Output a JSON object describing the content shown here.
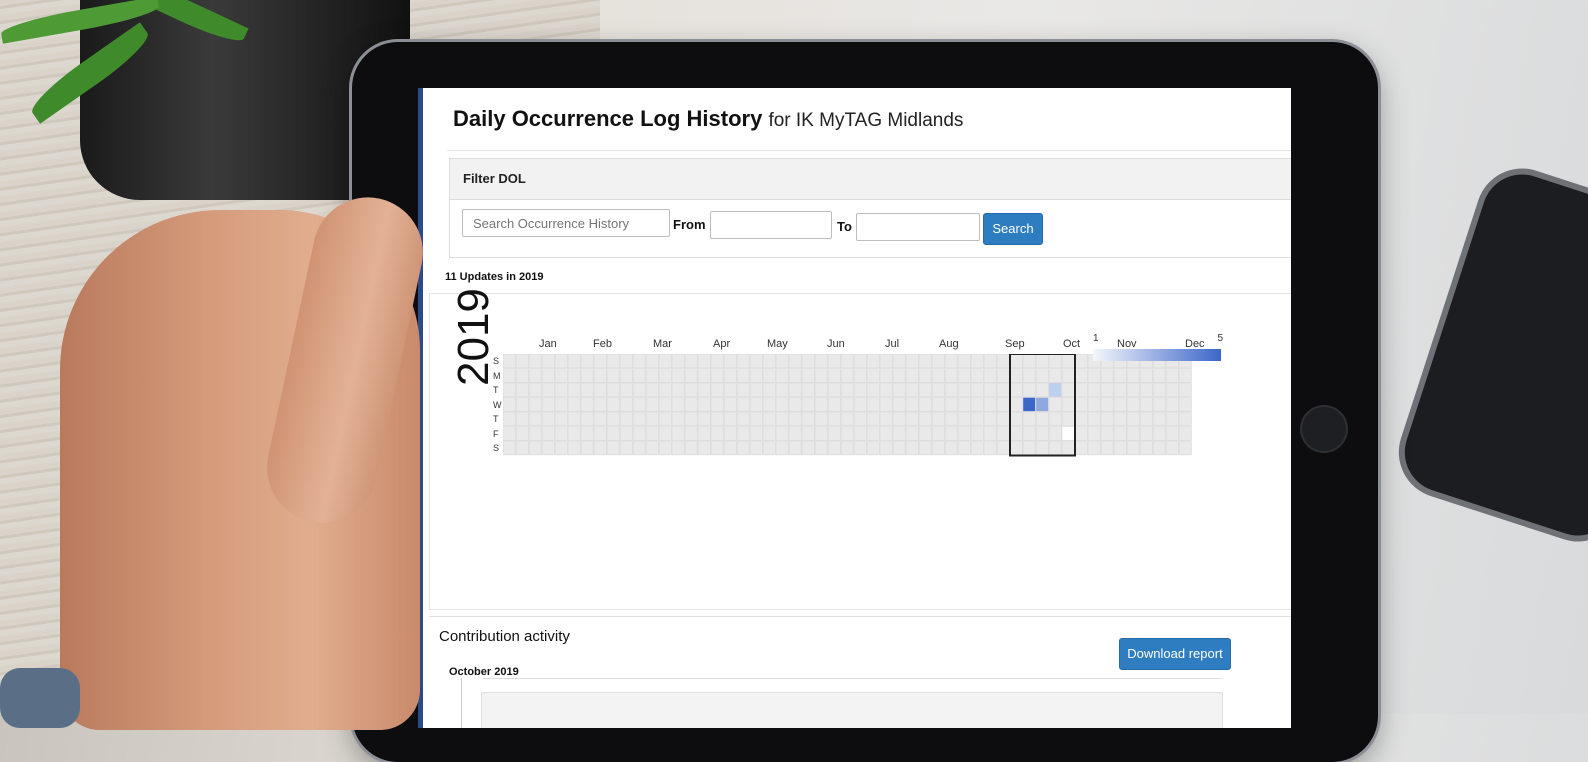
{
  "page": {
    "title_main": "Daily Occurrence Log History",
    "title_sub": "for IK MyTAG Midlands"
  },
  "filter": {
    "header": "Filter DOL",
    "search_placeholder": "Search Occurrence History",
    "from_label": "From :",
    "to_label": "To :",
    "search_button": "Search"
  },
  "calendar": {
    "summary": "11 Updates in 2019",
    "year": "2019",
    "months": [
      "Jan",
      "Feb",
      "Mar",
      "Apr",
      "May",
      "Jun",
      "Jul",
      "Aug",
      "Sep",
      "Oct",
      "Nov",
      "Dec"
    ],
    "weekdays": [
      "S",
      "M",
      "T",
      "W",
      "T",
      "F",
      "S"
    ],
    "legend_min": "1",
    "legend_max": "5",
    "colors": {
      "empty": "#e9e9e9",
      "low": "#bcd0f0",
      "mid": "#8ea9e0",
      "high": "#3c66c8",
      "highlight": "#222222"
    }
  },
  "activity": {
    "heading": "Contribution activity",
    "download_button": "Download report",
    "month_label": "October 2019"
  }
}
